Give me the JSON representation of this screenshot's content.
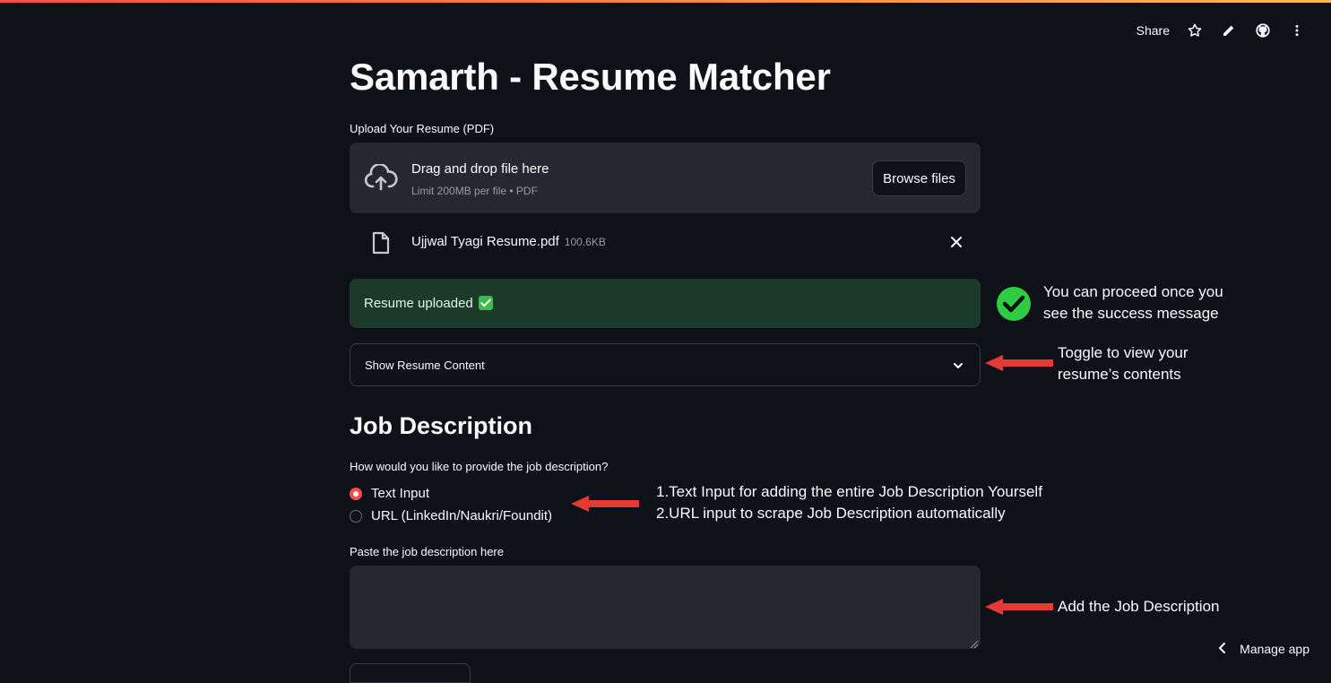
{
  "header": {
    "share_label": "Share",
    "icons": [
      "star-icon",
      "pencil-icon",
      "github-icon",
      "more-vert-icon"
    ]
  },
  "page": {
    "title": "Samarth - Resume Matcher"
  },
  "uploader": {
    "label": "Upload Your Resume (PDF)",
    "drop_title": "Drag and drop file here",
    "drop_sub": "Limit 200MB per file • PDF",
    "browse_label": "Browse files",
    "file_name": "Ujjwal Tyagi Resume.pdf",
    "file_size": "100.6KB"
  },
  "success": {
    "text": "Resume uploaded"
  },
  "expander": {
    "label": "Show Resume Content"
  },
  "job": {
    "heading": "Job Description",
    "question": "How would you like to provide the job description?",
    "options": [
      "Text Input",
      "URL (LinkedIn/Naukri/Foundit)"
    ],
    "selected": "Text Input",
    "textarea_label": "Paste the job description here",
    "textarea_value": ""
  },
  "annotations": {
    "success_note_line1": "You can proceed once you",
    "success_note_line2": "see the success message",
    "toggle_note_line1": "Toggle to view your",
    "toggle_note_line2": "resume’s contents",
    "option_note_1": "1.Text Input for adding the entire Job Description Yourself",
    "option_note_2": "2.URL input to scrape Job Description automatically",
    "textarea_note": "Add the Job Description"
  },
  "footer": {
    "manage_label": "Manage app"
  },
  "colors": {
    "background": "#0e1117",
    "primary": "#ff4b4b",
    "success_bg": "#1b3a2a",
    "annotation_arrow": "#e53935",
    "check_green": "#2ecc40"
  }
}
